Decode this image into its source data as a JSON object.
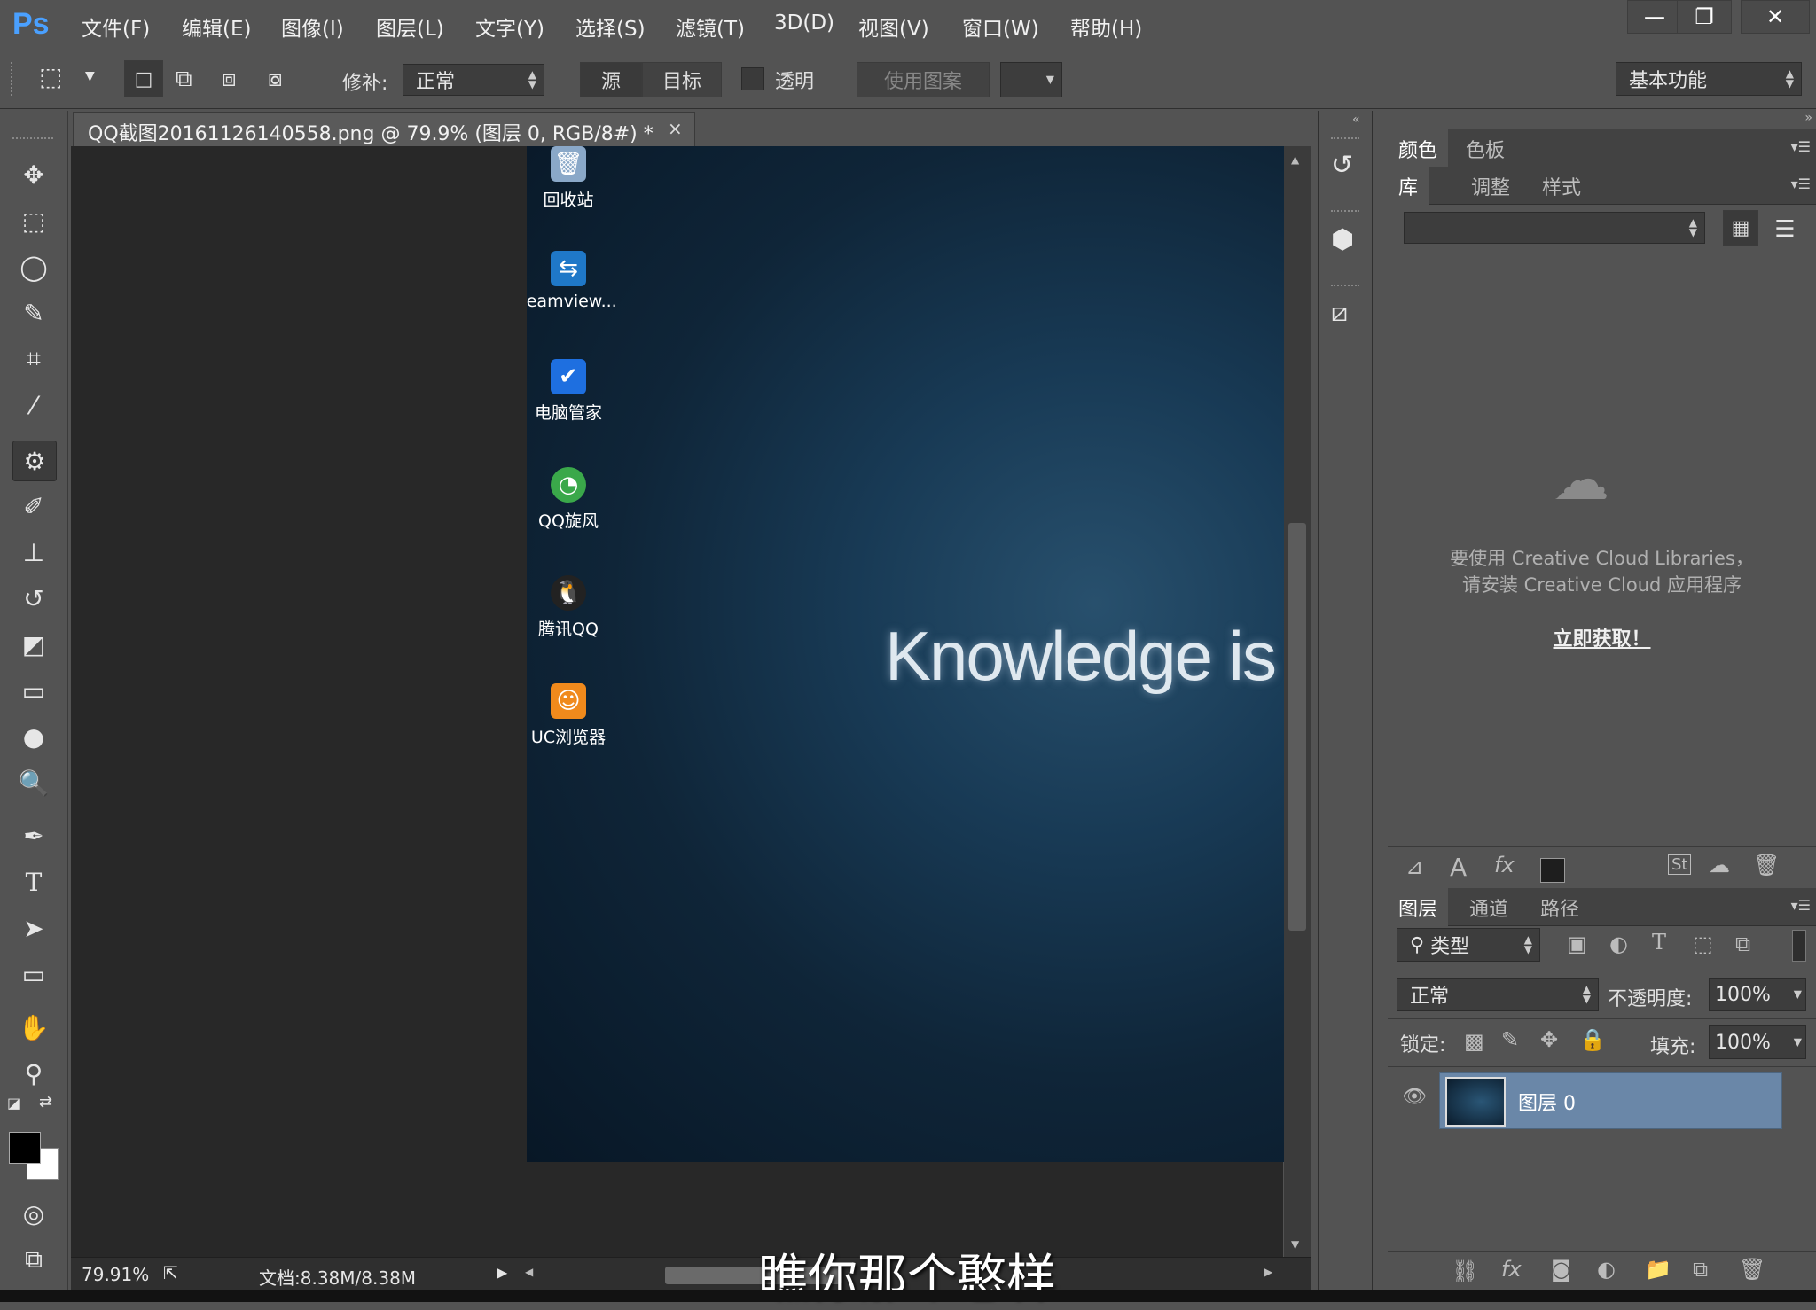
{
  "app": {
    "logo": "Ps"
  },
  "menu": [
    "文件(F)",
    "编辑(E)",
    "图像(I)",
    "图层(L)",
    "文字(Y)",
    "选择(S)",
    "滤镜(T)",
    "3D(D)",
    "视图(V)",
    "窗口(W)",
    "帮助(H)"
  ],
  "window_controls": {
    "minimize": "—",
    "restore": "❐",
    "close": "✕"
  },
  "options": {
    "patch_label": "修补:",
    "patch_mode": "正常",
    "source_label": "源",
    "target_label": "目标",
    "transparent_label": "透明",
    "use_pattern_label": "使用图案",
    "workspace": "基本功能"
  },
  "document": {
    "tab_title": "QQ截图20161126140558.png @ 79.9% (图层 0, RGB/8#) *",
    "close": "×",
    "canvas_text": "Knowledge is"
  },
  "desktop_icons": [
    {
      "label": "回收站",
      "icon": "recycle-bin-icon",
      "color": "#8aa8c8"
    },
    {
      "label": "teamview...",
      "icon": "teamviewer-icon",
      "color": "#1f78c8"
    },
    {
      "label": "电脑管家",
      "icon": "pc-manager-icon",
      "color": "#1e6fe0"
    },
    {
      "label": "QQ旋风",
      "icon": "qq-whirlwind-icon",
      "color": "#3aa84a"
    },
    {
      "label": "腾讯QQ",
      "icon": "qq-penguin-icon",
      "color": "#222222"
    },
    {
      "label": "UC浏览器",
      "icon": "uc-browser-icon",
      "color": "#f08a1c"
    }
  ],
  "status": {
    "zoom": "79.91%",
    "doc_size": "文档:8.38M/8.38M"
  },
  "panels": {
    "color_tabs": [
      "颜色",
      "色板"
    ],
    "lib_tabs": [
      "库",
      "调整",
      "样式"
    ],
    "lib_message_line1": "要使用 Creative Cloud Libraries，",
    "lib_message_line2": "请安装 Creative Cloud 应用程序",
    "lib_link": "立即获取！",
    "layers_tabs": [
      "图层",
      "通道",
      "路径"
    ],
    "filter_kind": "类型",
    "blend_mode": "正常",
    "opacity_label": "不透明度:",
    "opacity_value": "100%",
    "lock_label": "锁定:",
    "fill_label": "填充:",
    "fill_value": "100%",
    "layer_name": "图层 0"
  },
  "caption": "瞧你那个憨样"
}
